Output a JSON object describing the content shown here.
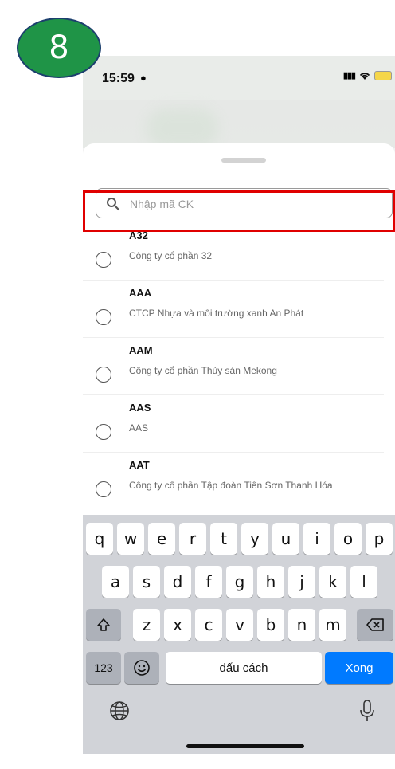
{
  "step_badge": "8",
  "status_bar": {
    "time": "15:59"
  },
  "search": {
    "placeholder": "Nhập mã CK",
    "value": ""
  },
  "stocks": [
    {
      "code": "A32",
      "name": "Công ty cổ phần 32"
    },
    {
      "code": "AAA",
      "name": "CTCP Nhựa và môi trường xanh An Phát"
    },
    {
      "code": "AAM",
      "name": "Công ty cổ phần Thủy sản Mekong"
    },
    {
      "code": "AAS",
      "name": "AAS"
    },
    {
      "code": "AAT",
      "name": "Công ty cổ phần Tập đoàn Tiên Sơn Thanh Hóa"
    }
  ],
  "keyboard": {
    "row1": [
      "q",
      "w",
      "e",
      "r",
      "t",
      "y",
      "u",
      "i",
      "o",
      "p"
    ],
    "row2": [
      "a",
      "s",
      "d",
      "f",
      "g",
      "h",
      "j",
      "k",
      "l"
    ],
    "row3": [
      "z",
      "x",
      "c",
      "v",
      "b",
      "n",
      "m"
    ],
    "numbers_label": "123",
    "space_label": "dấu cách",
    "done_label": "Xong"
  },
  "colors": {
    "badge": "#1f9447",
    "highlight": "#e00000",
    "done_key": "#007aff"
  }
}
